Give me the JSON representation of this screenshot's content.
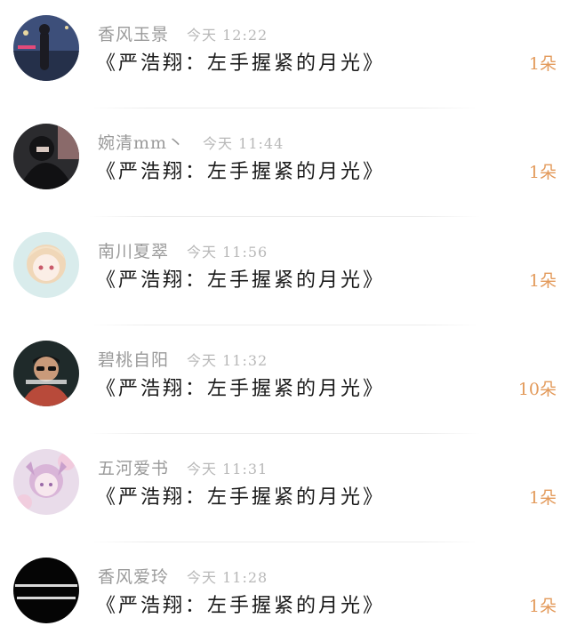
{
  "items": [
    {
      "name": "香风玉景",
      "time": "今天 12:22",
      "title": "《严浩翔：左手握紧的月光》",
      "flowers": "1朵",
      "avatar_icon": "girl-at-night-icon",
      "colors": {
        "bg": "#3d4f7a",
        "accent": "#e34a7a"
      }
    },
    {
      "name": "婉清mm丶",
      "time": "今天 11:44",
      "title": "《严浩翔：左手握紧的月光》",
      "flowers": "1朵",
      "avatar_icon": "dark-hooded-person-icon",
      "colors": {
        "bg": "#2b2b2e",
        "accent": "#8a6a6a"
      }
    },
    {
      "name": "南川夏翠",
      "time": "今天 11:56",
      "title": "《严浩翔：左手握紧的月光》",
      "flowers": "1朵",
      "avatar_icon": "anime-girl-icon",
      "colors": {
        "bg": "#d9ecec",
        "accent": "#f0d7b8"
      }
    },
    {
      "name": "碧桃自阳",
      "time": "今天 11:32",
      "title": "《严浩翔：左手握紧的月光》",
      "flowers": "10朵",
      "avatar_icon": "boy-with-sunglasses-icon",
      "colors": {
        "bg": "#1f2a2a",
        "accent": "#b84a3a"
      }
    },
    {
      "name": "五河爱书",
      "time": "今天 11:31",
      "title": "《严浩翔：左手握紧的月光》",
      "flowers": "1朵",
      "avatar_icon": "pink-anime-girl-icon",
      "colors": {
        "bg": "#e9dcea",
        "accent": "#d9b5d8"
      }
    },
    {
      "name": "香风爱玲",
      "time": "今天 11:28",
      "title": "《严浩翔：左手握紧的月光》",
      "flowers": "1朵",
      "avatar_icon": "black-text-avatar-icon",
      "colors": {
        "bg": "#050505",
        "accent": "#ffffff"
      }
    }
  ]
}
